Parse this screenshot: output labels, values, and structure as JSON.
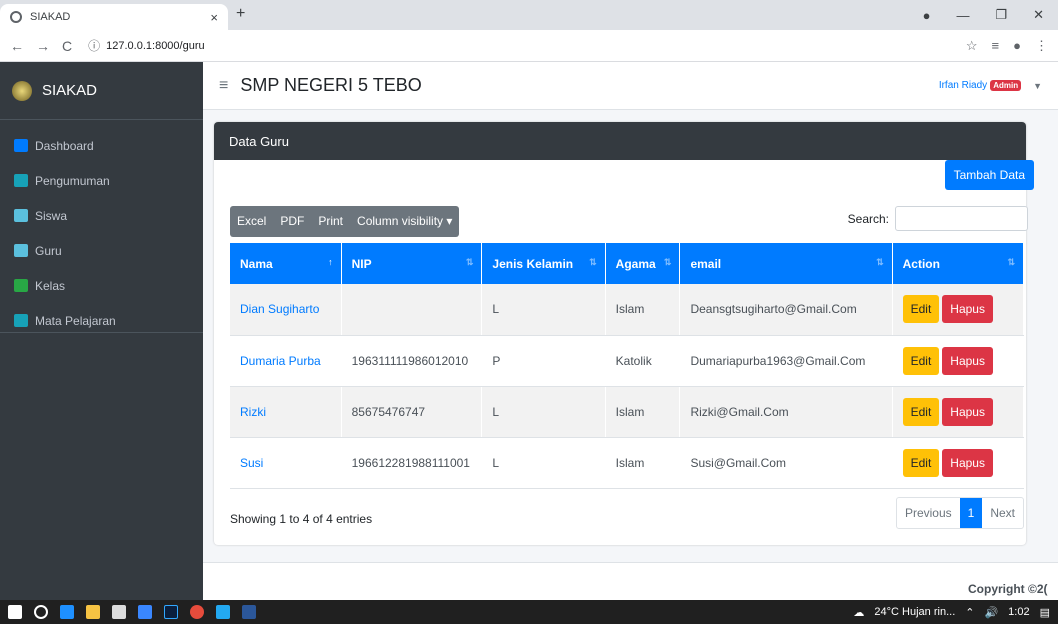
{
  "browser": {
    "tab_title": "SIAKAD",
    "url": "127.0.0.1:8000/guru"
  },
  "sidebar": {
    "brand": "SIAKAD",
    "items": [
      {
        "label": "Dashboard",
        "color": "#007bff"
      },
      {
        "label": "Pengumuman",
        "color": "#17a2b8"
      },
      {
        "label": "Siswa",
        "color": "#5bc0de"
      },
      {
        "label": "Guru",
        "color": "#5bc0de"
      },
      {
        "label": "Kelas",
        "color": "#28a745"
      },
      {
        "label": "Mata Pelajaran",
        "color": "#17a2b8"
      }
    ]
  },
  "header": {
    "school": "SMP NEGERI 5 TEBO",
    "user": "Irfan Riady",
    "role": "Admin"
  },
  "card": {
    "title": "Data Guru",
    "add_button": "Tambah Data",
    "export": [
      "Excel",
      "PDF",
      "Print",
      "Column visibility ▾"
    ],
    "search_label": "Search:",
    "columns": [
      "Nama",
      "NIP",
      "Jenis Kelamin",
      "Agama",
      "email",
      "Action"
    ],
    "rows": [
      [
        "Dian Sugiharto",
        "",
        "L",
        "Islam",
        "Deansgtsugiharto@Gmail.Com"
      ],
      [
        "Dumaria Purba",
        "196311111986012010",
        "P",
        "Katolik",
        "Dumariapurba1963@Gmail.Com"
      ],
      [
        "Rizki",
        "85675476747",
        "L",
        "Islam",
        "Rizki@Gmail.Com"
      ],
      [
        "Susi",
        "196612281988111001",
        "L",
        "Islam",
        "Susi@Gmail.Com"
      ]
    ],
    "edit_label": "Edit",
    "delete_label": "Hapus",
    "info": "Showing 1 to 4 of 4 entries",
    "pager": {
      "prev": "Previous",
      "page": "1",
      "next": "Next"
    }
  },
  "footer": {
    "copyright": "Copyright ©2("
  },
  "taskbar": {
    "weather": "24°C Hujan rin...",
    "time": "1:02"
  }
}
